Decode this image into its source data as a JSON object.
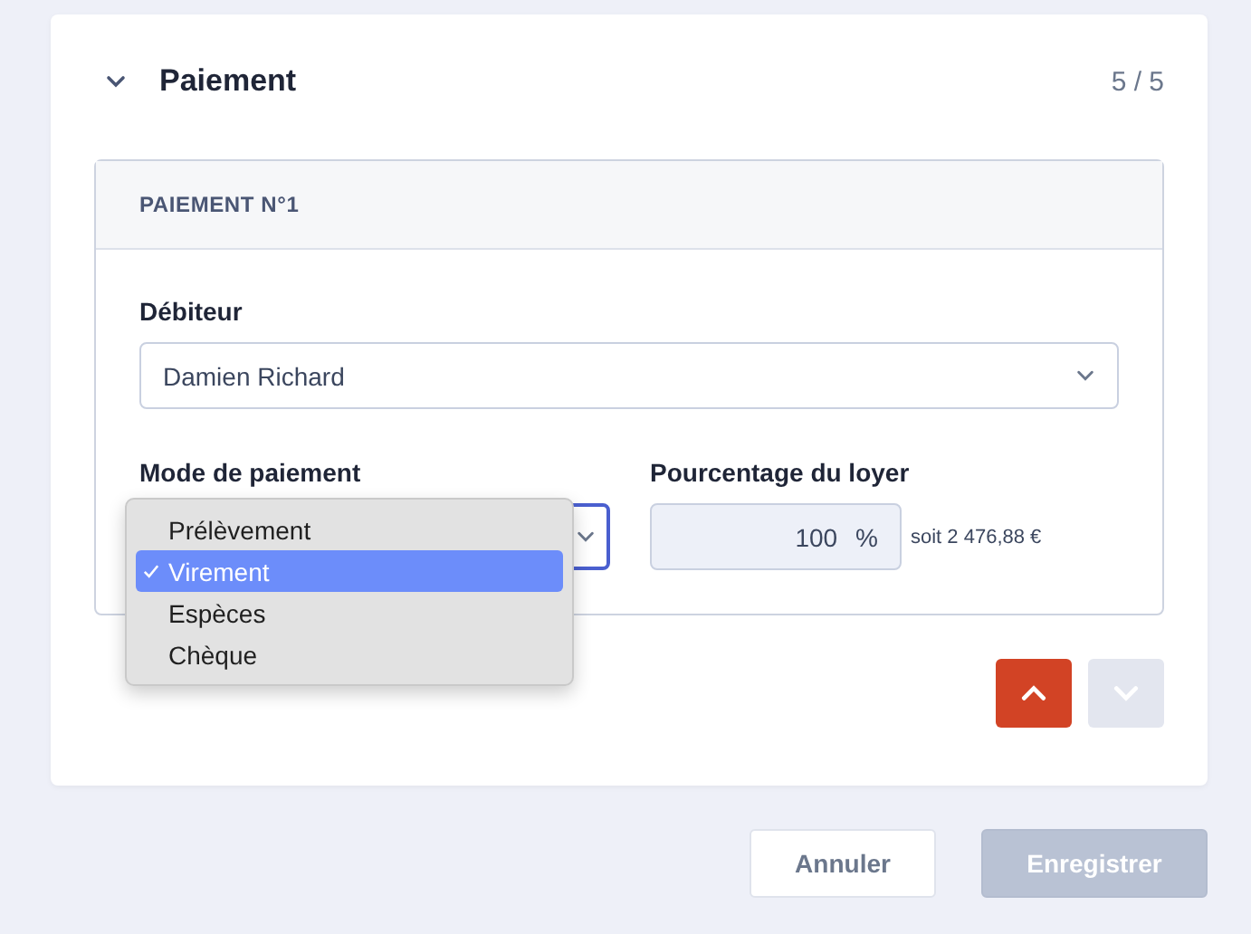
{
  "section": {
    "title": "Paiement",
    "expanded": true,
    "progress": "5 / 5"
  },
  "payment": {
    "title": "PAIEMENT N°1",
    "debtor": {
      "label": "Débiteur",
      "value": "Damien Richard"
    },
    "mode": {
      "label": "Mode de paiement",
      "open": true,
      "options": [
        {
          "label": "Prélèvement",
          "selected": false
        },
        {
          "label": "Virement",
          "selected": true
        },
        {
          "label": "Espèces",
          "selected": false
        },
        {
          "label": "Chèque",
          "selected": false
        }
      ]
    },
    "percentage": {
      "label": "Pourcentage du loyer",
      "value": "100",
      "unit": "%",
      "note": "soit 2 476,88 €"
    }
  },
  "move_buttons": [
    {
      "kind": "up",
      "disabled": false
    },
    {
      "kind": "down",
      "disabled": true
    }
  ],
  "footer": {
    "cancel": "Annuler",
    "save": {
      "label": "Enregistrer",
      "disabled": true
    }
  }
}
